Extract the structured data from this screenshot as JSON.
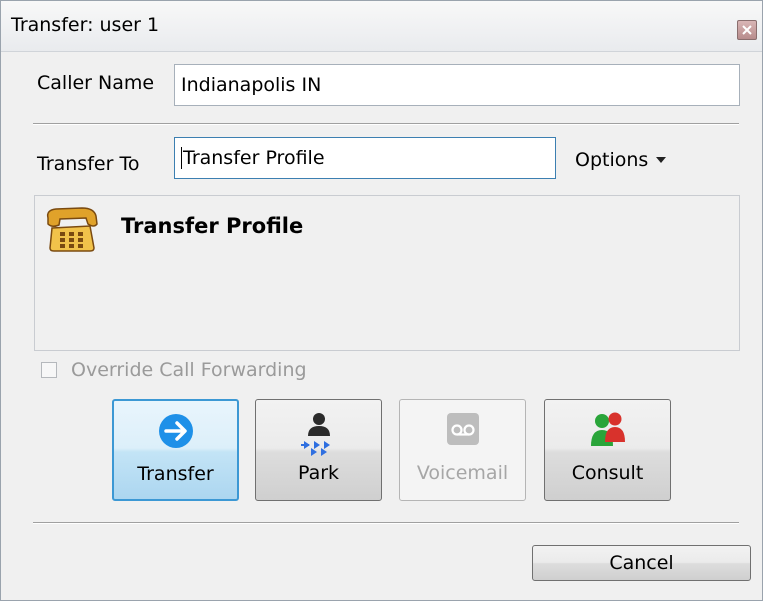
{
  "window": {
    "title": "Transfer: user 1"
  },
  "caller": {
    "label": "Caller Name",
    "value": "Indianapolis IN"
  },
  "transfer_to": {
    "label": "Transfer To",
    "value": "Transfer Profile",
    "options_label": "Options"
  },
  "result": {
    "name": "Transfer Profile",
    "icon": "phone-icon"
  },
  "override": {
    "label": "Override Call Forwarding",
    "checked": false,
    "enabled": false
  },
  "actions": [
    {
      "label": "Transfer",
      "icon": "arrow-right-circle-icon",
      "enabled": true,
      "default": true
    },
    {
      "label": "Park",
      "icon": "park-person-icon",
      "enabled": true,
      "default": false
    },
    {
      "label": "Voicemail",
      "icon": "voicemail-icon",
      "enabled": false,
      "default": false
    },
    {
      "label": "Consult",
      "icon": "consult-people-icon",
      "enabled": true,
      "default": false
    }
  ],
  "cancel": {
    "label": "Cancel"
  },
  "colors": {
    "accent": "#3c98d4",
    "transfer_icon": "#1e90e8",
    "park_arrows": "#2f6fe0",
    "consult_green": "#2aa53a",
    "consult_red": "#d8322c"
  }
}
